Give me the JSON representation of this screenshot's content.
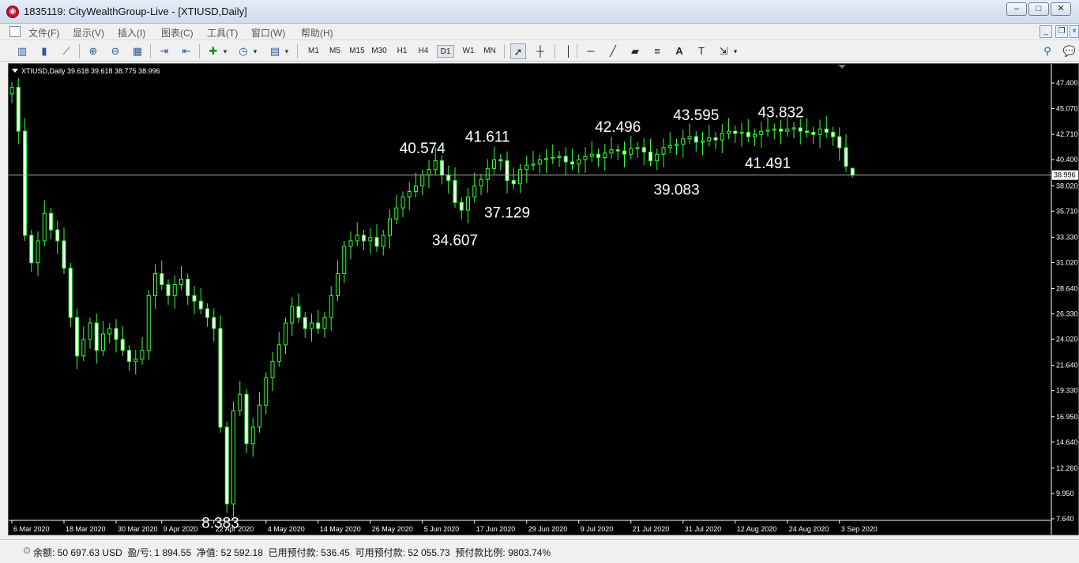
{
  "window": {
    "title": "1835119: CityWealthGroup-Live - [XTIUSD,Daily]",
    "icon": "app-logo-icon",
    "controls": [
      "minimize",
      "maximize",
      "close"
    ]
  },
  "menu": [
    {
      "label": "文件(F)"
    },
    {
      "label": "显示(V)"
    },
    {
      "label": "插入(I)"
    },
    {
      "label": "图表(C)"
    },
    {
      "label": "工具(T)"
    },
    {
      "label": "窗口(W)"
    },
    {
      "label": "帮助(H)"
    }
  ],
  "toolbar": {
    "timeframes": [
      "M1",
      "M5",
      "M15",
      "M30",
      "H1",
      "H4",
      "D1",
      "W1",
      "MN"
    ],
    "active_timeframe": "D1"
  },
  "chart": {
    "header": "XTIUSD,Daily  39.618 39.618 38.775 38.996",
    "current_price_label": "38.996",
    "background": "#000000",
    "candle_color": "#33ff33",
    "bull_fill": "#000000",
    "bear_fill": "#ffffff"
  },
  "chart_data": {
    "type": "candlestick",
    "symbol": "XTIUSD",
    "timeframe": "Daily",
    "ohlc_last": {
      "open": 39.618,
      "high": 39.618,
      "low": 38.775,
      "close": 38.996
    },
    "ylim": [
      7.64,
      48.7
    ],
    "y_ticks": [
      "47.400",
      "45.070",
      "42.710",
      "40.400",
      "38.020",
      "35.710",
      "33.330",
      "31.020",
      "28.640",
      "26.330",
      "24.020",
      "21.640",
      "19.330",
      "16.950",
      "14.640",
      "12.260",
      "9.950",
      "7.640"
    ],
    "x_tick_labels": [
      "6 Mar 2020",
      "18 Mar 2020",
      "30 Mar 2020",
      "9 Apr 2020",
      "22 Apr 2020",
      "4 May 2020",
      "14 May 2020",
      "26 May 2020",
      "5 Jun 2020",
      "17 Jun 2020",
      "29 Jun 2020",
      "9 Jul 2020",
      "21 Jul 2020",
      "31 Jul 2020",
      "12 Aug 2020",
      "24 Aug 2020",
      "3 Sep 2020"
    ],
    "annotations": [
      {
        "text": "8.383",
        "value": 8.383,
        "date": "21 Apr 2020"
      },
      {
        "text": "40.574",
        "value": 40.574,
        "date": "8 Jun 2020"
      },
      {
        "text": "34.607",
        "value": 34.607,
        "date": "15 Jun 2020"
      },
      {
        "text": "41.611",
        "value": 41.611,
        "date": "23 Jun 2020"
      },
      {
        "text": "37.129",
        "value": 37.129,
        "date": "26 Jun 2020"
      },
      {
        "text": "42.496",
        "value": 42.496,
        "date": "22 Jul 2020"
      },
      {
        "text": "43.595",
        "value": 43.595,
        "date": "5 Aug 2020"
      },
      {
        "text": "39.083",
        "value": 39.083,
        "date": "31 Jul 2020"
      },
      {
        "text": "43.832",
        "value": 43.832,
        "date": "26 Aug 2020"
      },
      {
        "text": "41.491",
        "value": 41.491,
        "date": "21 Aug 2020"
      }
    ],
    "current_price": 38.996,
    "closes": [
      47.0,
      43.0,
      33.5,
      31.0,
      33.0,
      35.5,
      34.0,
      33.0,
      30.5,
      26.0,
      22.5,
      24.0,
      25.5,
      23.0,
      24.5,
      25.0,
      24.0,
      23.0,
      22.0,
      22.2,
      23.0,
      28.0,
      30.0,
      29.0,
      28.0,
      29.0,
      29.5,
      28.0,
      27.5,
      26.8,
      26.0,
      25.0,
      16.0,
      9.0,
      17.5,
      19.0,
      14.5,
      16.0,
      18.0,
      20.5,
      22.0,
      23.5,
      25.5,
      27.0,
      26.0,
      25.0,
      25.5,
      25.0,
      26.0,
      28.0,
      30.0,
      32.5,
      33.0,
      33.5,
      33.0,
      33.3,
      32.5,
      33.5,
      35.0,
      36.0,
      37.0,
      37.5,
      38.0,
      39.0,
      39.5,
      40.3,
      39.0,
      38.5,
      36.5,
      35.8,
      37.0,
      38.0,
      38.6,
      39.6,
      40.4,
      40.3,
      38.5,
      38.2,
      39.5,
      39.9,
      40.0,
      40.4,
      40.5,
      40.6,
      40.7,
      40.2,
      40.0,
      40.4,
      40.7,
      40.9,
      40.6,
      41.0,
      41.3,
      41.2,
      40.9,
      41.4,
      41.5,
      41.1,
      40.3,
      40.9,
      41.5,
      41.7,
      41.8,
      42.3,
      42.5,
      42.0,
      42.1,
      42.4,
      42.2,
      42.8,
      43.0,
      42.8,
      42.9,
      42.5,
      42.7,
      43.0,
      43.1,
      43.2,
      43.0,
      43.2,
      43.3,
      43.0,
      42.9,
      42.7,
      43.2,
      42.9,
      42.5,
      41.5,
      39.8,
      38.996
    ]
  },
  "status": {
    "balance_label": "余额:",
    "balance": "50 697.63 USD",
    "pl_label": "盈/亏:",
    "pl": "1 894.55",
    "equity_label": "净值:",
    "equity": "52 592.18",
    "margin_label": "已用预付款:",
    "margin": "536.45",
    "free_label": "可用预付款:",
    "free": "52 055.73",
    "level_label": "预付款比例:",
    "level": "9803.74%"
  }
}
